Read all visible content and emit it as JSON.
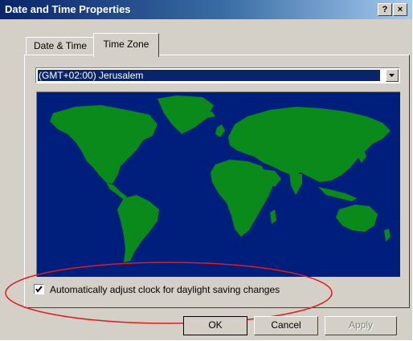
{
  "window": {
    "title": "Date and Time Properties",
    "help_glyph": "?",
    "close_glyph": "×"
  },
  "tabs": [
    {
      "label": "Date & Time",
      "active": false
    },
    {
      "label": "Time Zone",
      "active": true
    }
  ],
  "timezone": {
    "selected": "(GMT+02:00) Jerusalem"
  },
  "dst": {
    "label": "Automatically adjust clock for daylight saving changes",
    "checked": true
  },
  "buttons": {
    "ok": "OK",
    "cancel": "Cancel",
    "apply": "Apply"
  },
  "colors": {
    "title_bar": "#0a246a",
    "dialog_face": "#d4d0c8",
    "map_ocean": "#001e7b",
    "map_land": "#0a8a1a",
    "highlight_ellipse": "#e31b1b"
  },
  "icons": {
    "dropdown": "chevron-down-icon",
    "check": "checkmark-icon"
  }
}
